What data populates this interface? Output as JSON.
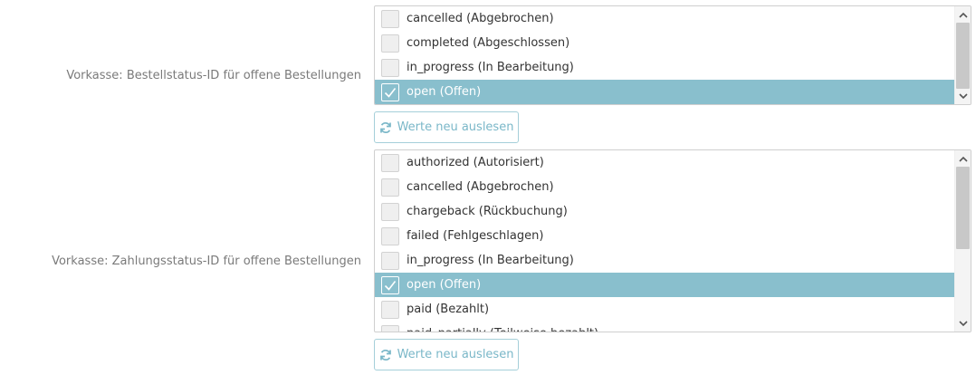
{
  "order_status": {
    "label": "Vorkasse: Bestellstatus-ID für offene Bestellungen",
    "options": [
      {
        "label": "cancelled (Abgebrochen)",
        "checked": false
      },
      {
        "label": "completed (Abgeschlossen)",
        "checked": false
      },
      {
        "label": "in_progress (In Bearbeitung)",
        "checked": false
      },
      {
        "label": "open (Offen)",
        "checked": true
      }
    ],
    "refresh_label": "Werte neu auslesen"
  },
  "payment_status": {
    "label": "Vorkasse: Zahlungsstatus-ID für offene Bestellungen",
    "options": [
      {
        "label": "authorized (Autorisiert)",
        "checked": false
      },
      {
        "label": "cancelled (Abgebrochen)",
        "checked": false
      },
      {
        "label": "chargeback (Rückbuchung)",
        "checked": false
      },
      {
        "label": "failed (Fehlgeschlagen)",
        "checked": false
      },
      {
        "label": "in_progress (In Bearbeitung)",
        "checked": false
      },
      {
        "label": "open (Offen)",
        "checked": true
      },
      {
        "label": "paid (Bezahlt)",
        "checked": false
      },
      {
        "label": "paid_partially (Teilweise bezahlt)",
        "checked": false
      }
    ],
    "refresh_label": "Werte neu auslesen"
  },
  "colors": {
    "selected_row": "#89bfcd",
    "button_text": "#7ab7c8",
    "button_border": "#a5cfd9"
  },
  "icons": {
    "check": "check-icon",
    "refresh": "refresh-icon",
    "scroll_up": "chevron-up-icon",
    "scroll_down": "chevron-down-icon"
  }
}
